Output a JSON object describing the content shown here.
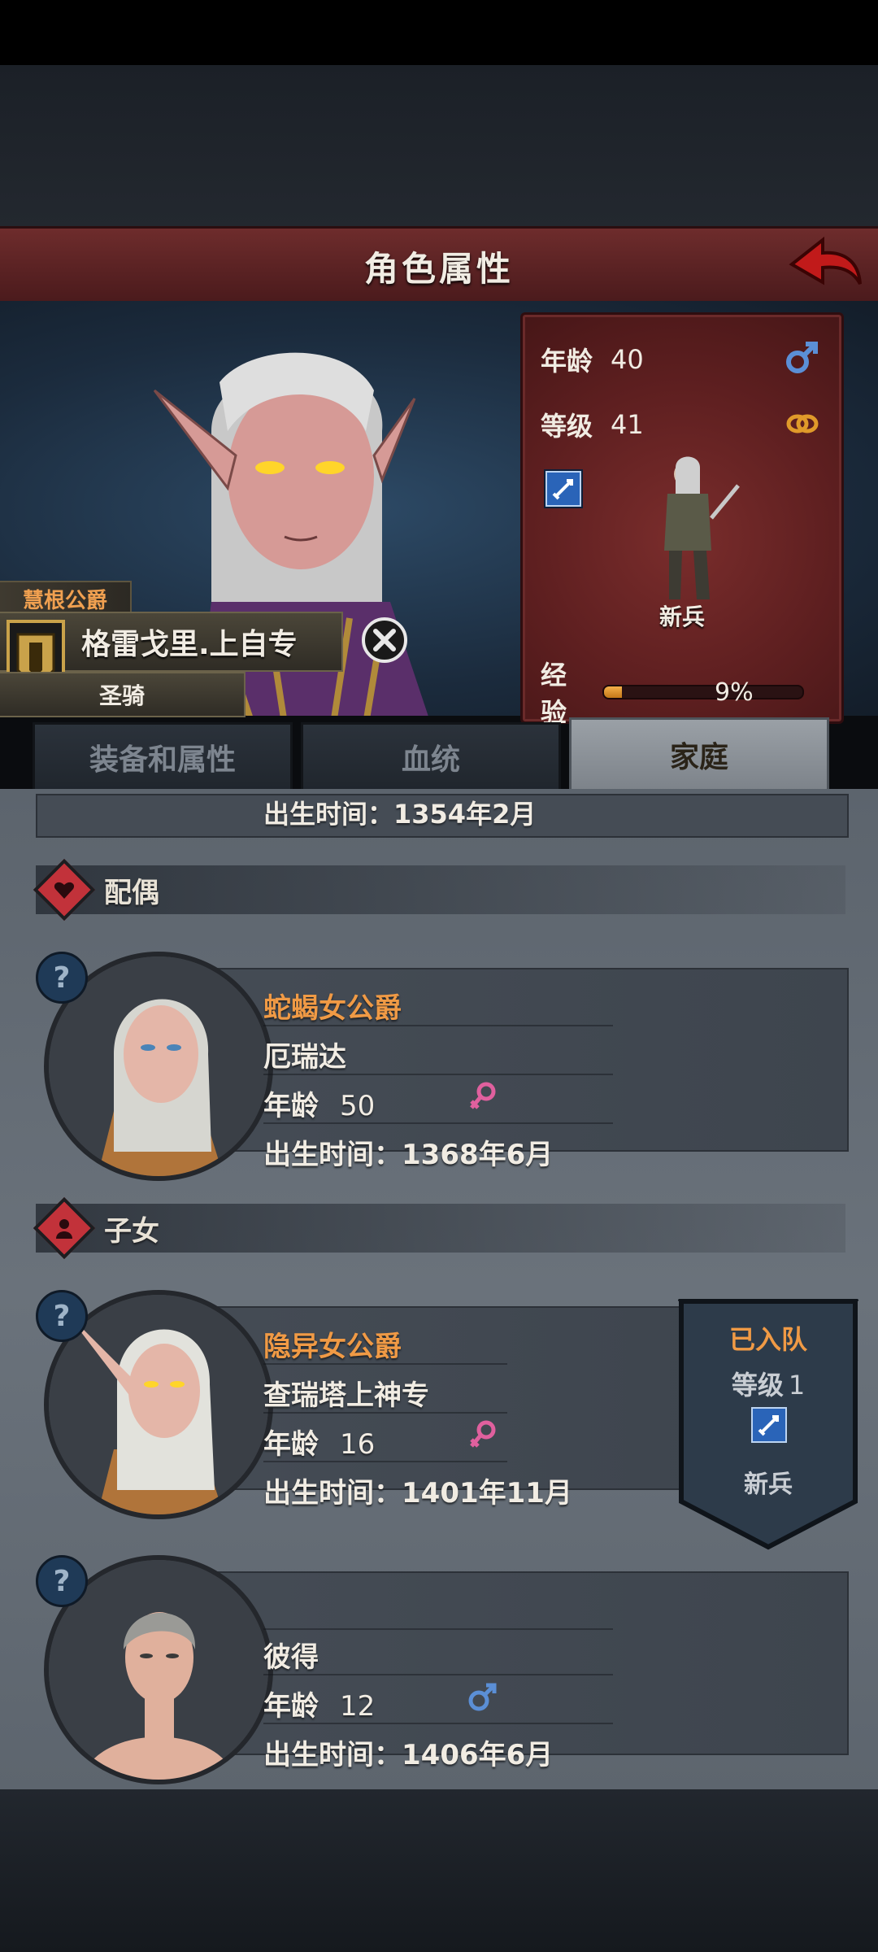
{
  "header": {
    "title": "角色属性"
  },
  "character": {
    "title": "慧根公爵",
    "name": "格雷戈里.上自专",
    "class": "圣骑"
  },
  "stats": {
    "age_label": "年龄",
    "age_value": "40",
    "level_label": "等级",
    "level_value": "41",
    "unit_name": "新兵",
    "exp_label": "经验",
    "exp_percent": "9%",
    "exp_fraction": 0.09
  },
  "tabs": [
    {
      "label": "装备和属性"
    },
    {
      "label": "血统"
    },
    {
      "label": "家庭"
    }
  ],
  "family": {
    "partial_birth": "出生时间：1354年2月",
    "spouse_section": "配偶",
    "children_section": "子女",
    "spouse": {
      "title": "蛇蝎女公爵",
      "name": "厄瑞达",
      "age_label": "年龄",
      "age": "50",
      "birth": "出生时间：1368年6月"
    },
    "children": [
      {
        "title": "隐异女公爵",
        "name": "查瑞塔上神专",
        "age_label": "年龄",
        "age": "16",
        "birth": "出生时间：1401年11月",
        "party": {
          "status": "已入队",
          "level_label": "等级",
          "level": "1",
          "unit": "新兵"
        }
      },
      {
        "title": "",
        "name": "彼得",
        "age_label": "年龄",
        "age": "12",
        "birth": "出生时间：1406年6月"
      }
    ]
  },
  "colors": {
    "header": "#6e2c2c",
    "title_orange": "#f09a45",
    "female": "#e0609e",
    "male": "#5b8fd6"
  }
}
